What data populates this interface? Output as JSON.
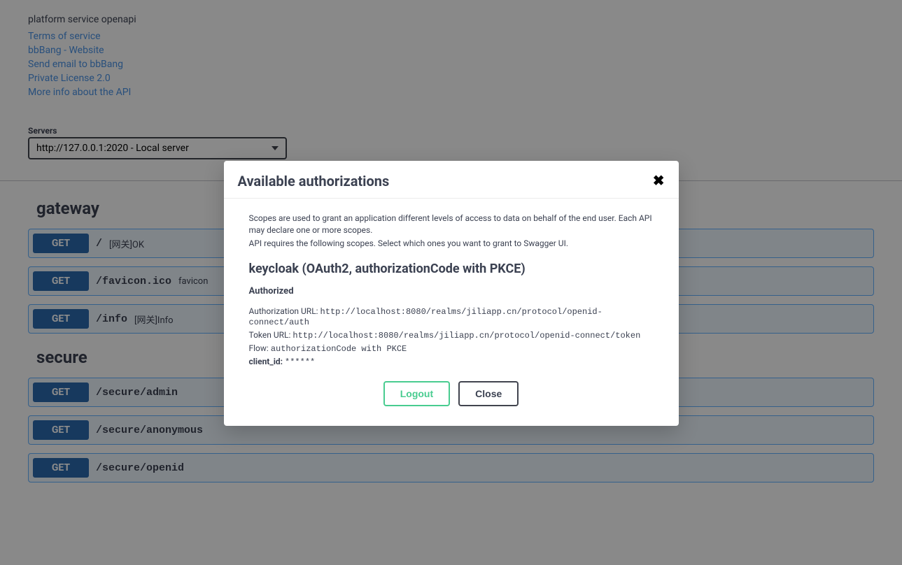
{
  "info": {
    "description": "platform service openapi",
    "links": {
      "terms": "Terms of service",
      "website": "bbBang - Website",
      "email": "Send email to bbBang",
      "license": "Private License 2.0",
      "more": "More info about the API"
    }
  },
  "servers": {
    "label": "Servers",
    "selected": "http://127.0.0.1:2020 - Local server"
  },
  "tags": [
    {
      "name": "gateway",
      "operations": [
        {
          "method": "GET",
          "path": "/",
          "summary": "[网关]OK"
        },
        {
          "method": "GET",
          "path": "/favicon.ico",
          "summary": "favicon"
        },
        {
          "method": "GET",
          "path": "/info",
          "summary": "[网关]Info"
        }
      ]
    },
    {
      "name": "secure",
      "operations": [
        {
          "method": "GET",
          "path": "/secure/admin",
          "summary": ""
        },
        {
          "method": "GET",
          "path": "/secure/anonymous",
          "summary": ""
        },
        {
          "method": "GET",
          "path": "/secure/openid",
          "summary": ""
        }
      ]
    }
  ],
  "modal": {
    "title": "Available authorizations",
    "scope_text_1": "Scopes are used to grant an application different levels of access to data on behalf of the end user. Each API may declare one or more scopes.",
    "scope_text_2": "API requires the following scopes. Select which ones you want to grant to Swagger UI.",
    "auth_title": "keycloak (OAuth2, authorizationCode with PKCE)",
    "authorized_label": "Authorized",
    "auth_url_label": "Authorization URL:",
    "auth_url": "http://localhost:8080/realms/jiliapp.cn/protocol/openid-connect/auth",
    "token_url_label": "Token URL:",
    "token_url": "http://localhost:8080/realms/jiliapp.cn/protocol/openid-connect/token",
    "flow_label": "Flow:",
    "flow": "authorizationCode with PKCE",
    "client_id_label": "client_id:",
    "client_id": "******",
    "logout": "Logout",
    "close": "Close",
    "close_x": "✖"
  }
}
